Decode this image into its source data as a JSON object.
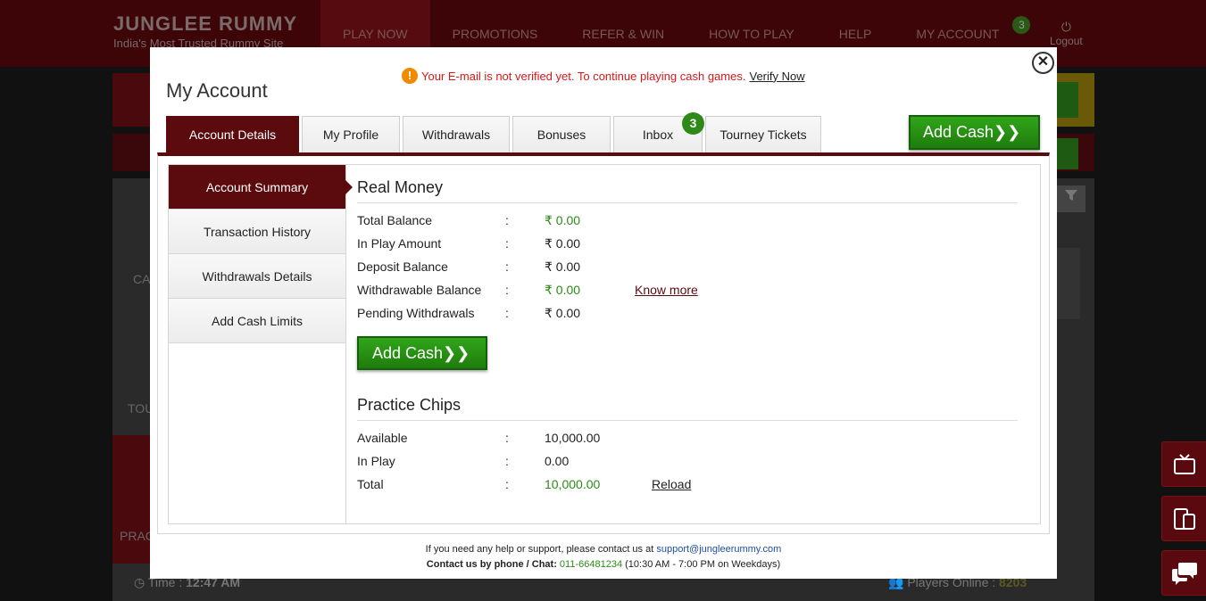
{
  "header": {
    "brand": "JUNGLEE RUMMY",
    "tagline": "India's Most Trusted Rummy Site",
    "nav": [
      "PLAY NOW",
      "PROMOTIONS",
      "REFER & WIN",
      "HOW TO PLAY",
      "HELP",
      "MY ACCOUNT"
    ],
    "account_badge": "3",
    "logout": "Logout"
  },
  "background": {
    "label_ca": "CA",
    "label_tou": "TOU",
    "label_prac": "PRAC",
    "filter_icon": "filter-icon"
  },
  "footer": {
    "time_label": "Time :",
    "time_value": "12:47 AM",
    "online_label": "Players Online :",
    "online_value": "8203"
  },
  "side_buttons": [
    "tv-icon",
    "mobile-icon",
    "chat-icon"
  ],
  "modal": {
    "title": "My Account",
    "verify": {
      "message": "Your E-mail is not verified yet. To continue playing cash games.",
      "link": "Verify Now"
    },
    "tabs": [
      {
        "label": "Account Details",
        "active": true
      },
      {
        "label": "My Profile"
      },
      {
        "label": "Withdrawals"
      },
      {
        "label": "Bonuses"
      },
      {
        "label": "Inbox",
        "badge": "3"
      },
      {
        "label": "Tourney Tickets"
      }
    ],
    "add_cash": "Add Cash❯❯",
    "left_nav": [
      "Account Summary",
      "Transaction History",
      "Withdrawals Details",
      "Add Cash Limits"
    ],
    "real_money": {
      "title": "Real Money",
      "rows": [
        {
          "label": "Total Balance",
          "sep": ":",
          "value": "₹ 0.00"
        },
        {
          "label": "In Play Amount",
          "sep": ":",
          "value": "₹ 0.00"
        },
        {
          "label": "Deposit Balance",
          "sep": ":",
          "value": "₹ 0.00"
        },
        {
          "label": "Withdrawable Balance",
          "sep": ":",
          "value": "₹ 0.00",
          "link": "Know more"
        },
        {
          "label": "Pending Withdrawals",
          "sep": ":",
          "value": "₹ 0.00"
        }
      ]
    },
    "practice_chips": {
      "title": "Practice Chips",
      "rows": [
        {
          "label": "Available",
          "sep": ":",
          "value": "10,000.00"
        },
        {
          "label": "In Play",
          "sep": ":",
          "value": "0.00"
        },
        {
          "label": "Total",
          "sep": ":",
          "value": "10,000.00",
          "link": "Reload"
        }
      ]
    },
    "footer": {
      "help_text": "If you need any help or support, please contact us at",
      "email": "support@jungleerummy.com",
      "contact_label": "Contact us by phone / Chat:",
      "phone": "011-66481234",
      "hours": "(10:30 AM - 7:00 PM on Weekdays)"
    }
  },
  "colors": {
    "maroon": "#5b0a0d",
    "green": "#2b8a17",
    "warning": "#d81818"
  }
}
